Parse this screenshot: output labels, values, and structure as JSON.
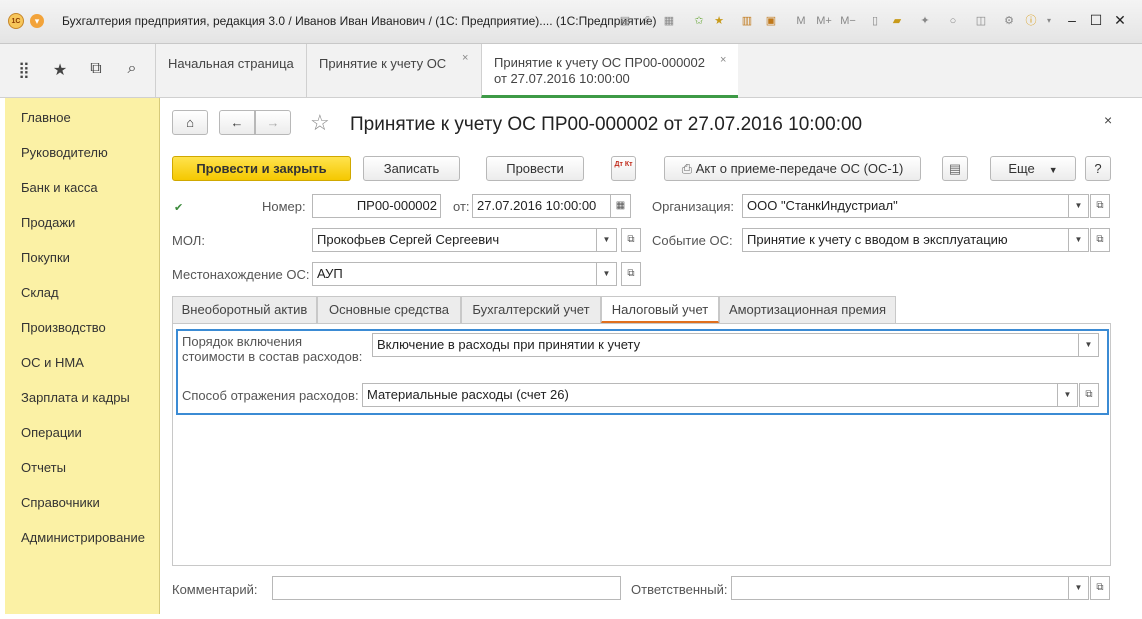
{
  "app": {
    "window_title": "Бухгалтерия предприятия, редакция 3.0 / Иванов Иван Иванович / (1С: Предприятие)....  (1С:Предприятие)",
    "logo_text": "1С"
  },
  "window_tabs": [
    {
      "label": "Начальная страница"
    },
    {
      "label": "Принятие к учету ОС"
    },
    {
      "label_line1": "Принятие к учету ОС ПР00-000002",
      "label_line2": "от 27.07.2016 10:00:00"
    }
  ],
  "sidebar": {
    "items": [
      {
        "label": "Главное"
      },
      {
        "label": "Руководителю"
      },
      {
        "label": "Банк и касса"
      },
      {
        "label": "Продажи"
      },
      {
        "label": "Покупки"
      },
      {
        "label": "Склад"
      },
      {
        "label": "Производство"
      },
      {
        "label": "ОС и НМА"
      },
      {
        "label": "Зарплата и кадры"
      },
      {
        "label": "Операции"
      },
      {
        "label": "Отчеты"
      },
      {
        "label": "Справочники"
      },
      {
        "label": "Администрирование"
      }
    ]
  },
  "document": {
    "title": "Принятие к учету ОС ПР00-000002 от 27.07.2016 10:00:00",
    "toolbar": {
      "post_close": "Провести и закрыть",
      "save": "Записать",
      "post": "Провести",
      "dt_kt": "Дт Кт",
      "act": "Акт о приеме-передаче ОС (ОС-1)",
      "more": "Еще",
      "help": "?"
    },
    "fields": {
      "number_label": "Номер:",
      "number_value": "ПР00-000002",
      "from_label": "от:",
      "date_value": "27.07.2016 10:00:00",
      "org_label": "Организация:",
      "org_value": "ООО \"СтанкИндустриал\"",
      "mol_label": "МОЛ:",
      "mol_value": "Прокофьев Сергей Сергеевич",
      "event_label": "Событие ОС:",
      "event_value": "Принятие к учету с вводом в эксплуатацию",
      "location_label": "Местонахождение ОС:",
      "location_value": "АУП"
    },
    "tabs": [
      {
        "label": "Внеоборотный актив"
      },
      {
        "label": "Основные средства"
      },
      {
        "label": "Бухгалтерский учет"
      },
      {
        "label": "Налоговый учет"
      },
      {
        "label": "Амортизационная премия"
      }
    ],
    "tax": {
      "order_label_1": "Порядок включения",
      "order_label_2": "стоимости в состав расходов:",
      "order_value": "Включение в расходы при принятии к учету",
      "method_label": "Способ отражения расходов:",
      "method_value": "Материальные расходы (счет 26)"
    },
    "footer": {
      "comment_label": "Комментарий:",
      "comment_value": "",
      "responsible_label": "Ответственный:",
      "responsible_value": ""
    }
  }
}
